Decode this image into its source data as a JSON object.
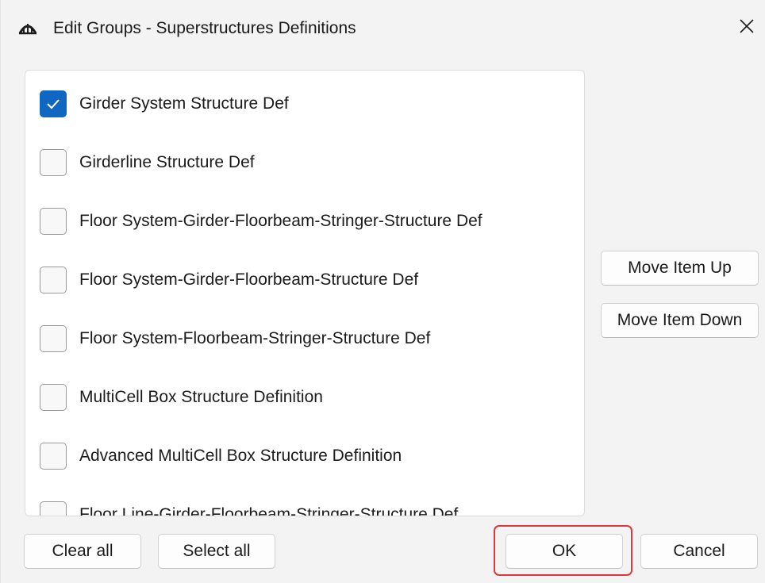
{
  "window": {
    "title": "Edit Groups - Superstructures Definitions",
    "app_icon": "bridge-icon",
    "close_icon": "close-icon"
  },
  "list": {
    "items": [
      {
        "label": "Girder System Structure Def",
        "checked": true
      },
      {
        "label": "Girderline Structure Def",
        "checked": false
      },
      {
        "label": "Floor System-Girder-Floorbeam-Stringer-Structure Def",
        "checked": false
      },
      {
        "label": "Floor System-Girder-Floorbeam-Structure Def",
        "checked": false
      },
      {
        "label": "Floor System-Floorbeam-Stringer-Structure Def",
        "checked": false
      },
      {
        "label": "MultiCell Box Structure Definition",
        "checked": false
      },
      {
        "label": "Advanced MultiCell Box Structure Definition",
        "checked": false
      },
      {
        "label": "Floor Line-Girder-Floorbeam-Stringer-Structure Def",
        "checked": false
      }
    ]
  },
  "side_buttons": {
    "move_up": "Move Item Up",
    "move_down": "Move Item Down"
  },
  "footer": {
    "clear_all": "Clear all",
    "select_all": "Select all",
    "ok": "OK",
    "cancel": "Cancel"
  },
  "colors": {
    "accent": "#0f67c2",
    "highlight": "#e0363e",
    "background": "#f3f3f3"
  }
}
